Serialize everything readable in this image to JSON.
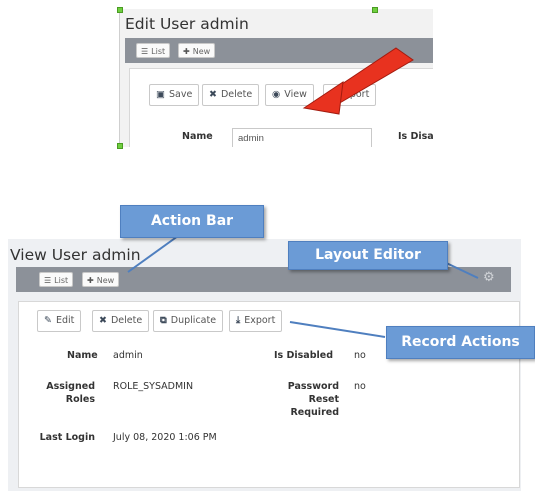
{
  "edit_view": {
    "title": "Edit User admin",
    "action_bar": {
      "list_label": "List",
      "new_label": "New"
    },
    "record_actions": {
      "save": "Save",
      "delete": "Delete",
      "view": "View",
      "export": "Export"
    },
    "fields": {
      "name_label": "Name",
      "name_value": "admin",
      "disabled_label": "Is Disat"
    }
  },
  "view_view": {
    "title": "View User admin",
    "action_bar": {
      "list_label": "List",
      "new_label": "New"
    },
    "record_actions": {
      "edit": "Edit",
      "delete": "Delete",
      "duplicate": "Duplicate",
      "export": "Export"
    },
    "fields": {
      "name_label": "Name",
      "name_value": "admin",
      "disabled_label": "Is Disabled",
      "disabled_value": "no",
      "roles_label_1": "Assigned",
      "roles_label_2": "Roles",
      "roles_value": "ROLE_SYSADMIN",
      "pw_label_1": "Password",
      "pw_label_2": "Reset",
      "pw_label_3": "Required",
      "pw_value": "no",
      "login_label": "Last Login",
      "login_value": "July 08, 2020 1:06 PM"
    }
  },
  "callouts": {
    "action_bar": "Action Bar",
    "layout_editor": "Layout Editor",
    "record_actions": "Record Actions"
  },
  "icons": {
    "list": "list-icon",
    "new": "plus-icon",
    "save": "save-icon",
    "delete": "delete-icon",
    "view": "eye-icon",
    "export": "export-icon",
    "edit": "edit-icon",
    "duplicate": "duplicate-icon",
    "gear": "gear-icon"
  },
  "colors": {
    "callout_fill": "#6b9bd6",
    "arrow_red": "#e8321f",
    "action_bar": "#8c9199"
  }
}
